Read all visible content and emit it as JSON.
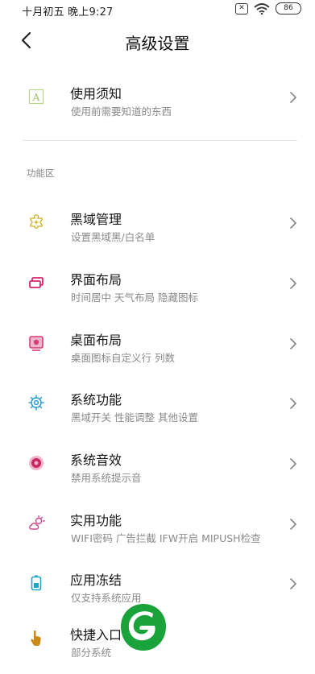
{
  "status": {
    "time": "十月初五 晚上9:27",
    "battery": "86",
    "sim": "✕"
  },
  "header": {
    "title": "高级设置"
  },
  "notice": {
    "title": "使用须知",
    "subtitle": "使用前需要知道的东西",
    "icon": "letter-a-icon"
  },
  "section": {
    "label": "功能区"
  },
  "items": [
    {
      "title": "黑域管理",
      "subtitle": "设置黑域黑/白名单",
      "icon": "puzzle-plus-icon",
      "color": "#c9b21a"
    },
    {
      "title": "界面布局",
      "subtitle": "时间居中 天气布局 隐藏图标",
      "icon": "windows-icon",
      "color": "#d6246c"
    },
    {
      "title": "桌面布局",
      "subtitle": "桌面图标自定义行 列数",
      "icon": "desktop-icon",
      "color": "#d83a78"
    },
    {
      "title": "系统功能",
      "subtitle": "黑域开关 性能调整 其他设置",
      "icon": "gear-icon",
      "color": "#2a9fd8"
    },
    {
      "title": "系统音效",
      "subtitle": "禁用系统提示音",
      "icon": "speaker-icon",
      "color": "#c8265f"
    },
    {
      "title": "实用功能",
      "subtitle": "WIFI密码 广告拦截 IFW开启 MIPUSH检查",
      "icon": "cloud-sun-icon",
      "color": "#d0488c"
    },
    {
      "title": "应用冻结",
      "subtitle": "仅支持系统应用",
      "icon": "battery-icon",
      "color": "#1fa6c9"
    },
    {
      "title": "快捷入口",
      "subtitle": "部分系统",
      "icon": "hand-pointer-icon",
      "color": "#c98a18"
    }
  ],
  "colors": {
    "brand_green": "#1aa33a",
    "chevron": "#8c8c8c"
  }
}
